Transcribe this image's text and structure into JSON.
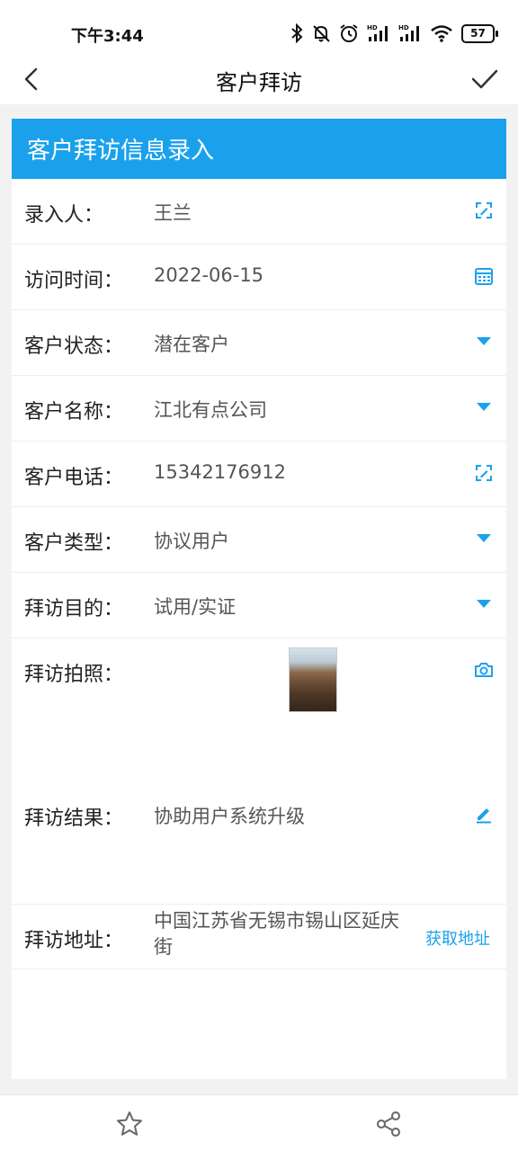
{
  "status_bar": {
    "time": "下午3:44",
    "battery": "57",
    "icons": [
      "bluetooth-icon",
      "mute-icon",
      "alarm-icon",
      "signal-hd-icon",
      "signal-hd-icon",
      "wifi-icon",
      "battery-icon"
    ]
  },
  "nav": {
    "title": "客户拜访",
    "back_icon": "chevron-left-icon",
    "done_icon": "check-icon"
  },
  "form": {
    "header": "客户拜访信息录入",
    "fields": {
      "recorder": {
        "label": "录入人：",
        "value": "王兰",
        "icon": "edit-box-icon"
      },
      "visit_time": {
        "label": "访问时间：",
        "value": "2022-06-15",
        "icon": "calendar-icon"
      },
      "customer_status": {
        "label": "客户状态：",
        "value": "潜在客户",
        "icon": "dropdown-triangle-icon"
      },
      "customer_name": {
        "label": "客户名称：",
        "value": "江北有点公司",
        "icon": "dropdown-triangle-icon"
      },
      "customer_phone": {
        "label": "客户电话：",
        "value": "15342176912",
        "icon": "edit-box-icon"
      },
      "customer_type": {
        "label": "客户类型：",
        "value": "协议用户",
        "icon": "dropdown-triangle-icon"
      },
      "visit_purpose": {
        "label": "拜访目的：",
        "value": "试用/实证",
        "icon": "dropdown-triangle-icon"
      },
      "visit_photo": {
        "label": "拜访拍照：",
        "icon": "camera-icon"
      },
      "visit_result": {
        "label": "拜访结果：",
        "value": "协助用户系统升级",
        "icon": "pencil-icon"
      },
      "visit_address": {
        "label": "拜访地址：",
        "value": "中国江苏省无锡市锡山区延庆街",
        "button": "获取地址"
      }
    }
  },
  "bottom_bar": {
    "icons": [
      "star-icon",
      "share-icon"
    ]
  },
  "colors": {
    "accent": "#1ba1ec",
    "header_text": "#ffffff",
    "background": "#f2f2f2"
  }
}
